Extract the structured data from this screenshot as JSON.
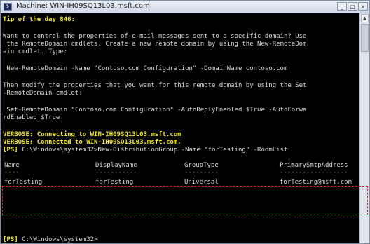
{
  "window": {
    "title": "Machine: WIN-IH09SQ13L03.msft.com",
    "buttons": [
      "_",
      "□",
      "×"
    ]
  },
  "console": {
    "tip_title": "Tip of the day 846:",
    "para1": [
      "Want to control the properties of e-mail messages sent to a specific domain? Use",
      " the RemoteDomain cmdlets. Create a new remote domain by using the New-RemoteDom",
      "ain cmdlet. Type:"
    ],
    "cmd1": " New-RemoteDomain -Name \"Contoso.com Configuration\" -DomainName contoso.com",
    "para2": [
      "Then modify the properties that you want for this remote domain by using the Set",
      "-RemoteDomain cmdlet:"
    ],
    "cmd2": [
      " Set-RemoteDomain \"Contoso.com Configuration\" -AutoReplyEnabled $True -AutoForwa",
      "rdEnabled $True"
    ],
    "verbose1": "VERBOSE: Connecting to WIN-IH09SQ13L03.msft.com",
    "verbose2": "VERBOSE: Connected to WIN-IH09SQ13L03.msft.com.",
    "prompt_label": "[PS]",
    "prompt_path": "C:\\Windows\\system32>",
    "command3": "New-DistributionGroup -Name \"forTesting\" -RoomList",
    "table": {
      "headers": [
        "Name",
        "DisplayName",
        "GroupType",
        "PrimarySmtpAddress"
      ],
      "underlines": [
        "----",
        "-----------",
        "---------",
        "------------------"
      ],
      "row": [
        "forTesting",
        "forTesting",
        "Universal",
        "forTesting@msft.com"
      ]
    },
    "final_prompt_label": "[PS]",
    "final_prompt_path": "C:\\Windows\\system32>"
  }
}
